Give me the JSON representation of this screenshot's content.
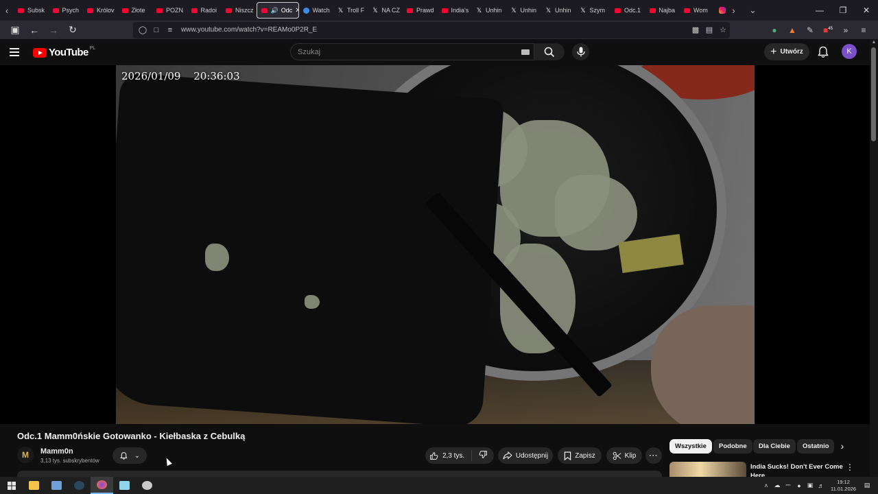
{
  "browser": {
    "tabs": [
      {
        "label": "Subsk",
        "icon": "youtube-favicon"
      },
      {
        "label": "Psych",
        "icon": "youtube-favicon"
      },
      {
        "label": "Królov",
        "icon": "youtube-favicon"
      },
      {
        "label": "Złote",
        "icon": "youtube-favicon"
      },
      {
        "label": "POZN",
        "icon": "youtube-favicon"
      },
      {
        "label": "Radoi",
        "icon": "youtube-favicon"
      },
      {
        "label": "Niszcz",
        "icon": "youtube-favicon"
      },
      {
        "label": "Odc",
        "icon": "youtube-favicon",
        "active": true
      },
      {
        "label": "Watch",
        "icon": "dual-favicon"
      },
      {
        "label": "Troll F",
        "icon": "x-favicon"
      },
      {
        "label": "NA CZ",
        "icon": "x-favicon"
      },
      {
        "label": "Prawd",
        "icon": "youtube-favicon"
      },
      {
        "label": "India's",
        "icon": "youtube-favicon"
      },
      {
        "label": "Unhin",
        "icon": "x-favicon"
      },
      {
        "label": "Unhin",
        "icon": "x-favicon"
      },
      {
        "label": "Unhin",
        "icon": "x-favicon"
      },
      {
        "label": "Szym",
        "icon": "x-favicon"
      },
      {
        "label": "Odc.1",
        "icon": "youtube-favicon"
      },
      {
        "label": "Najba",
        "icon": "youtube-favicon"
      },
      {
        "label": "Wom",
        "icon": "youtube-favicon"
      }
    ],
    "url": "www.youtube.com/watch?v=REAMo0P2R_E",
    "extension_badge": "45"
  },
  "youtube": {
    "logo_text": "YouTube",
    "country_code": "PL",
    "search_placeholder": "Szukaj",
    "create_label": "Utwórz",
    "avatar_letter": "K"
  },
  "video": {
    "timestamp_date": "2026/01/09",
    "timestamp_time": "20:36:03",
    "title": "Odc.1 Mamm0ńskie Gotowanko - Kiełbaska z Cebulką",
    "channel_name": "Mamm0n",
    "channel_avatar_letter": "M",
    "subscribers": "3,13 tys. subskrybentów",
    "likes": "2,3 tys.",
    "share_label": "Udostępnij",
    "save_label": "Zapisz",
    "clip_label": "Klip"
  },
  "filters": [
    {
      "label": "Wszystkie",
      "active": true
    },
    {
      "label": "Podobne"
    },
    {
      "label": "Dla Ciebie"
    },
    {
      "label": "Ostatnio"
    }
  ],
  "recommendation": {
    "title": "India Sucks! Don't Ever Come Here"
  },
  "taskbar": {
    "time": "19:12",
    "date": "11.01.2026"
  }
}
